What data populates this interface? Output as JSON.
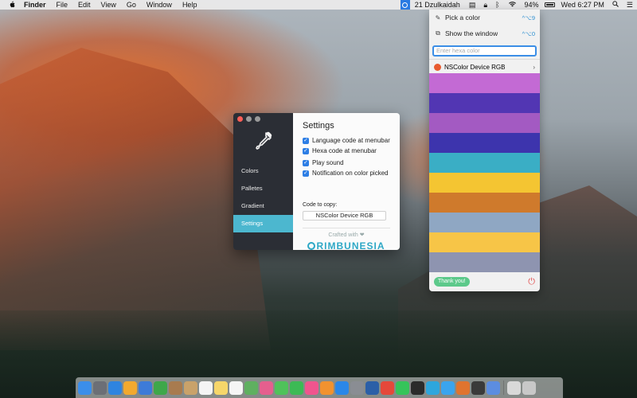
{
  "menubar": {
    "apple": "",
    "app": "Finder",
    "items": [
      "File",
      "Edit",
      "View",
      "Go",
      "Window",
      "Help"
    ],
    "status_text": "21 Dzulkaidah",
    "battery": "94%",
    "clock": "Wed 6:27 PM"
  },
  "settings": {
    "nav": [
      "Colors",
      "Palletes",
      "Gradient",
      "Settings"
    ],
    "title": "Settings",
    "options": [
      "Language code at menubar",
      "Hexa code at menubar",
      "Play sound",
      "Notification on color picked"
    ],
    "code_label": "Code to copy:",
    "code_value": "NSColor Device RGB",
    "crafted": "Crafted with ❤",
    "brand": "RIMBUNESIA"
  },
  "dropdown": {
    "pick_label": "Pick a color",
    "pick_shortcut": "^⌥9",
    "show_label": "Show the window",
    "show_shortcut": "^⌥0",
    "hex_placeholder": "Enter hexa color",
    "colorspace": "NSColor Device RGB",
    "thanks": "Thank you!"
  },
  "palette": [
    "#c36ad4",
    "#5236b3",
    "#a35ac2",
    "#3d34ad",
    "#3aaec5",
    "#f4c532",
    "#cf7a2c",
    "#8fa7c3",
    "#f7c547",
    "#8e94b0"
  ],
  "dock": {
    "icons": [
      {
        "name": "finder-icon",
        "color": "#3b8eea"
      },
      {
        "name": "launchpad-icon",
        "color": "#6c6f76"
      },
      {
        "name": "safari-icon",
        "color": "#2f84e0"
      },
      {
        "name": "sketch-icon",
        "color": "#f2a92e"
      },
      {
        "name": "xcode-icon",
        "color": "#3d7bd8"
      },
      {
        "name": "leaf-icon",
        "color": "#3ea74a"
      },
      {
        "name": "note-icon",
        "color": "#a87b4f"
      },
      {
        "name": "contacts-icon",
        "color": "#c9a26a"
      },
      {
        "name": "calendar-icon",
        "color": "#f4f4f4"
      },
      {
        "name": "notes-icon",
        "color": "#f6d66a"
      },
      {
        "name": "reminders-icon",
        "color": "#f5f5f5"
      },
      {
        "name": "maps-icon",
        "color": "#5fb060"
      },
      {
        "name": "photos-icon",
        "color": "#e55f8e"
      },
      {
        "name": "messages-icon",
        "color": "#4fc25a"
      },
      {
        "name": "facetime-icon",
        "color": "#3cba55"
      },
      {
        "name": "itunes-icon",
        "color": "#f0558e"
      },
      {
        "name": "ibooks-icon",
        "color": "#f1922f"
      },
      {
        "name": "appstore-icon",
        "color": "#2a87e8"
      },
      {
        "name": "preferences-icon",
        "color": "#8a8d93"
      },
      {
        "name": "cydia-icon",
        "color": "#2b5fa7"
      },
      {
        "name": "chrome-icon",
        "color": "#e5483a"
      },
      {
        "name": "whatsapp-icon",
        "color": "#35c45a"
      },
      {
        "name": "terminal-icon",
        "color": "#2b2b2b"
      },
      {
        "name": "telegram-icon",
        "color": "#2ea6dd"
      },
      {
        "name": "twitter-icon",
        "color": "#3aa4ee"
      },
      {
        "name": "sublime-icon",
        "color": "#e0742f"
      },
      {
        "name": "activity-icon",
        "color": "#3a3a3a"
      },
      {
        "name": "colorpicker-icon",
        "color": "#5c8de0"
      },
      {
        "name": "downloads-icon",
        "color": "#d9d9d9"
      },
      {
        "name": "trash-icon",
        "color": "#c8c8c8"
      }
    ]
  }
}
